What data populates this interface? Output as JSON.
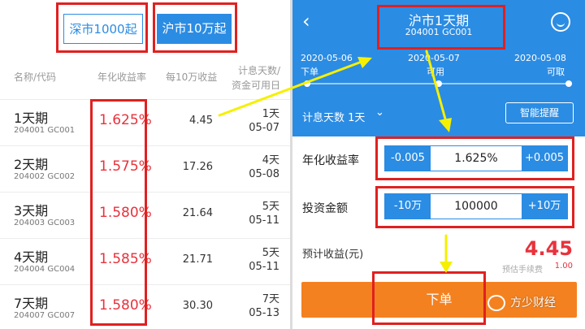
{
  "left": {
    "segments": [
      {
        "label": "深市1000起",
        "active": false
      },
      {
        "label": "沪市10万起",
        "active": true
      }
    ],
    "headers": {
      "name": "名称/代码",
      "rate": "年化收益率",
      "income": "每10万收益",
      "days_line1": "计息天数/",
      "days_line2": "资金可用日"
    },
    "rows": [
      {
        "name": "1天期",
        "code": "204001 GC001",
        "rate": "1.625%",
        "income": "4.45",
        "days": "1天",
        "date": "05-07"
      },
      {
        "name": "2天期",
        "code": "204002 GC002",
        "rate": "1.575%",
        "income": "17.26",
        "days": "4天",
        "date": "05-08"
      },
      {
        "name": "3天期",
        "code": "204003 GC003",
        "rate": "1.580%",
        "income": "21.64",
        "days": "5天",
        "date": "05-11"
      },
      {
        "name": "4天期",
        "code": "204004 GC004",
        "rate": "1.585%",
        "income": "21.71",
        "days": "5天",
        "date": "05-11"
      },
      {
        "name": "7天期",
        "code": "204007 GC007",
        "rate": "1.580%",
        "income": "30.30",
        "days": "7天",
        "date": "05-13"
      }
    ]
  },
  "right": {
    "title": "沪市1天期",
    "code": "204001 GC001",
    "back_icon": "chevron-left-icon",
    "service_icon": "customer-service-icon",
    "timeline": [
      {
        "date": "2020-05-06",
        "caption": "下单"
      },
      {
        "date": "2020-05-07",
        "caption": "可用"
      },
      {
        "date": "2020-05-08",
        "caption": "可取"
      }
    ],
    "days_label": "计息天数 1天",
    "days_caret": "⌄",
    "smart_button": "智能提醒",
    "rate": {
      "label": "年化收益率",
      "minus": "-0.005",
      "value": "1.625%",
      "plus": "+0.005"
    },
    "amount": {
      "label": "投资金额",
      "minus": "-10万",
      "value": "100000",
      "plus": "+10万"
    },
    "estimate": {
      "label": "预计收益(元)",
      "value": "4.45",
      "fee_label": "预估手续费",
      "fee_value": "1.00"
    },
    "order_button": "下单"
  },
  "watermark": "方少财经",
  "colors": {
    "brand_blue": "#2b8ce3",
    "rate_red": "#e8323c",
    "order_orange": "#f4811f",
    "annotation_red": "#e02020",
    "annotation_yellow": "#f5f000"
  }
}
